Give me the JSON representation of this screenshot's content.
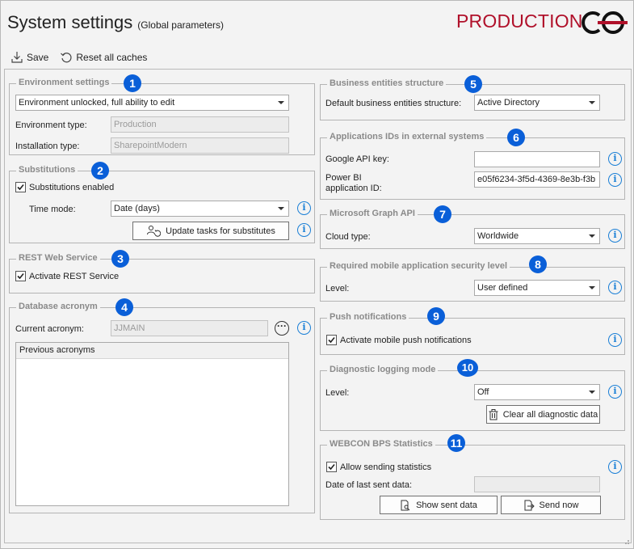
{
  "header": {
    "title": "System settings",
    "subtitle": "(Global parameters)",
    "environment_label": "PRODUCTION"
  },
  "toolbar": {
    "save_label": "Save",
    "reset_label": "Reset all caches"
  },
  "environment_settings": {
    "title": "Environment settings",
    "badge": "1",
    "mode_value": "Environment unlocked, full ability to edit",
    "env_type_label": "Environment type:",
    "env_type_value": "Production",
    "install_type_label": "Installation type:",
    "install_type_value": "SharepointModern"
  },
  "substitutions": {
    "title": "Substitutions",
    "badge": "2",
    "enabled_label": "Substitutions enabled",
    "enabled": true,
    "time_mode_label": "Time mode:",
    "time_mode_value": "Date (days)",
    "update_button": "Update tasks for substitutes"
  },
  "rest": {
    "title": "REST Web Service",
    "badge": "3",
    "activate_label": "Activate REST Service",
    "activated": true
  },
  "acronym": {
    "title": "Database acronym",
    "badge": "4",
    "current_label": "Current acronym:",
    "current_value": "JJMAIN",
    "previous_header": "Previous acronyms"
  },
  "business_entities": {
    "title": "Business entities structure",
    "badge": "5",
    "default_label": "Default business entities structure:",
    "default_value": "Active Directory"
  },
  "app_ids": {
    "title": "Applications IDs in external systems",
    "badge": "6",
    "google_label": "Google API key:",
    "google_value": "",
    "powerbi_label_1": "Power BI",
    "powerbi_label_2": "application ID:",
    "powerbi_value": "e05f6234-3f5d-4369-8e3b-f3b"
  },
  "graph": {
    "title": "Microsoft Graph API",
    "badge": "7",
    "cloud_label": "Cloud type:",
    "cloud_value": "Worldwide"
  },
  "mobile_security": {
    "title": "Required mobile application security level",
    "badge": "8",
    "level_label": "Level:",
    "level_value": "User defined"
  },
  "push": {
    "title": "Push notifications",
    "badge": "9",
    "activate_label": "Activate mobile push notifications",
    "activated": true
  },
  "diagnostic": {
    "title": "Diagnostic logging mode",
    "badge": "10",
    "level_label": "Level:",
    "level_value": "Off",
    "clear_button": "Clear all diagnostic data"
  },
  "statistics": {
    "title": "WEBCON BPS Statistics",
    "badge": "11",
    "allow_label": "Allow sending statistics",
    "allowed": true,
    "last_sent_label": "Date of last sent data:",
    "last_sent_value": "",
    "show_button": "Show sent data",
    "send_button": "Send now"
  },
  "colors": {
    "accent": "#0a5fd8",
    "production": "#b0102a",
    "info": "#1a7fd6"
  }
}
